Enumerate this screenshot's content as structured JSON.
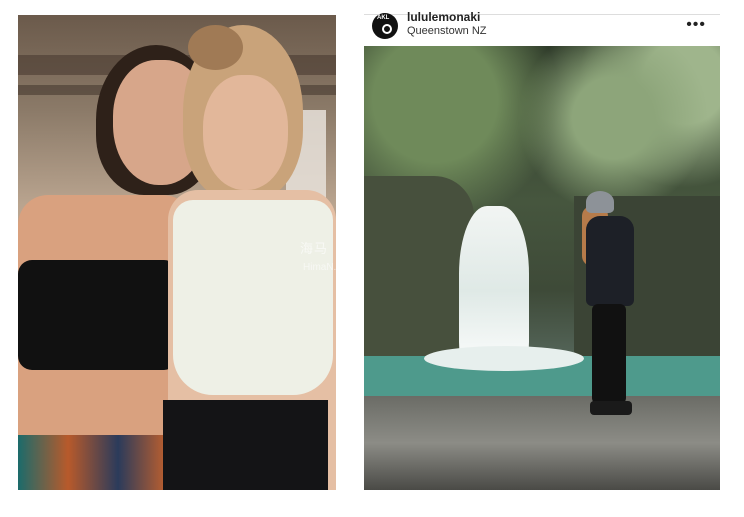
{
  "post": {
    "username": "lululemonaki",
    "location": "Queenstown NZ",
    "more_icon": "more-options-icon",
    "avatar_label": "AKL"
  },
  "watermark": {
    "text": "海马",
    "subtext": "HimaN..."
  },
  "left_photo": {
    "subject": "two-women-portrait"
  },
  "right_photo": {
    "subject": "hiker-at-waterfall"
  }
}
